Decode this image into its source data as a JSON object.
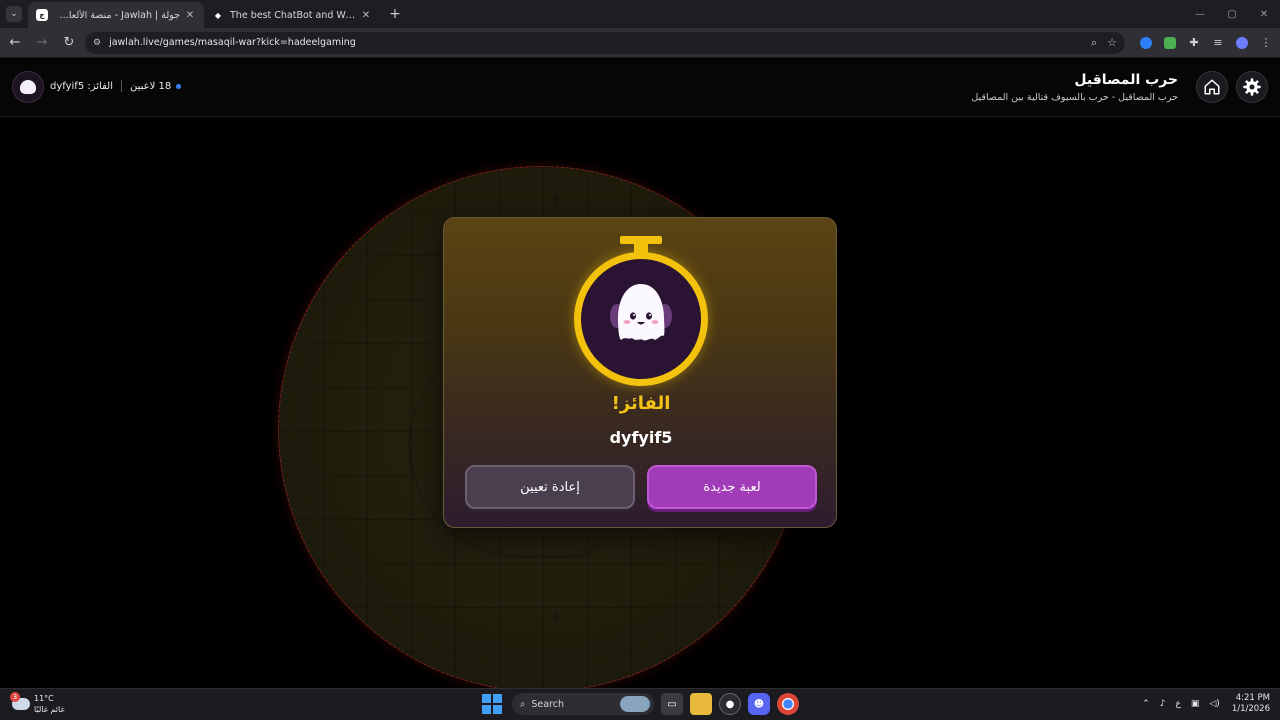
{
  "browser": {
    "tabs": [
      {
        "title": "جولة | Jawlah - منصة الألعاب التفاعلية",
        "active": true
      },
      {
        "title": "The best ChatBot and Widgets",
        "active": false
      }
    ],
    "new_tab_label": "+",
    "url": "jawlah.live/games/masaqil-war?kick=hadeelgaming",
    "icons": {
      "back": "←",
      "forward": "→",
      "reload": "↻",
      "site_info": "⚙",
      "zoom": "⌕",
      "bookmark": "☆",
      "minimize": "—",
      "maximize": "▢",
      "close": "✕",
      "tab_close": "✕",
      "tab_list": "⌄"
    }
  },
  "header": {
    "game_title": "حرب المصاقيل",
    "game_subtitle": "حرب المصاقيل - حرب بالسيوف قتالية بين المصاقيل",
    "winner_status": "الفائز: dyfyif5",
    "players_count": "18 لاعبين",
    "live_dot_color": "#3b82f6"
  },
  "arena": {
    "border_color": "#8b1a1a",
    "marks": [
      "c",
      "c"
    ]
  },
  "winner_modal": {
    "winner_label": "الفائز!",
    "winner_name": "dyfyif5",
    "new_game_label": "لعبة جديدة",
    "reset_label": "إعادة تعيين",
    "accent": "#f2c20d",
    "primary_button_color": "#a13bb7"
  },
  "taskbar": {
    "weather_temp": "11°C",
    "weather_desc": "غائم غالبًا",
    "weather_badge": "3",
    "search_label": "Search",
    "lang": "ع",
    "time": "4:21 PM",
    "date": "1/1/2026"
  }
}
